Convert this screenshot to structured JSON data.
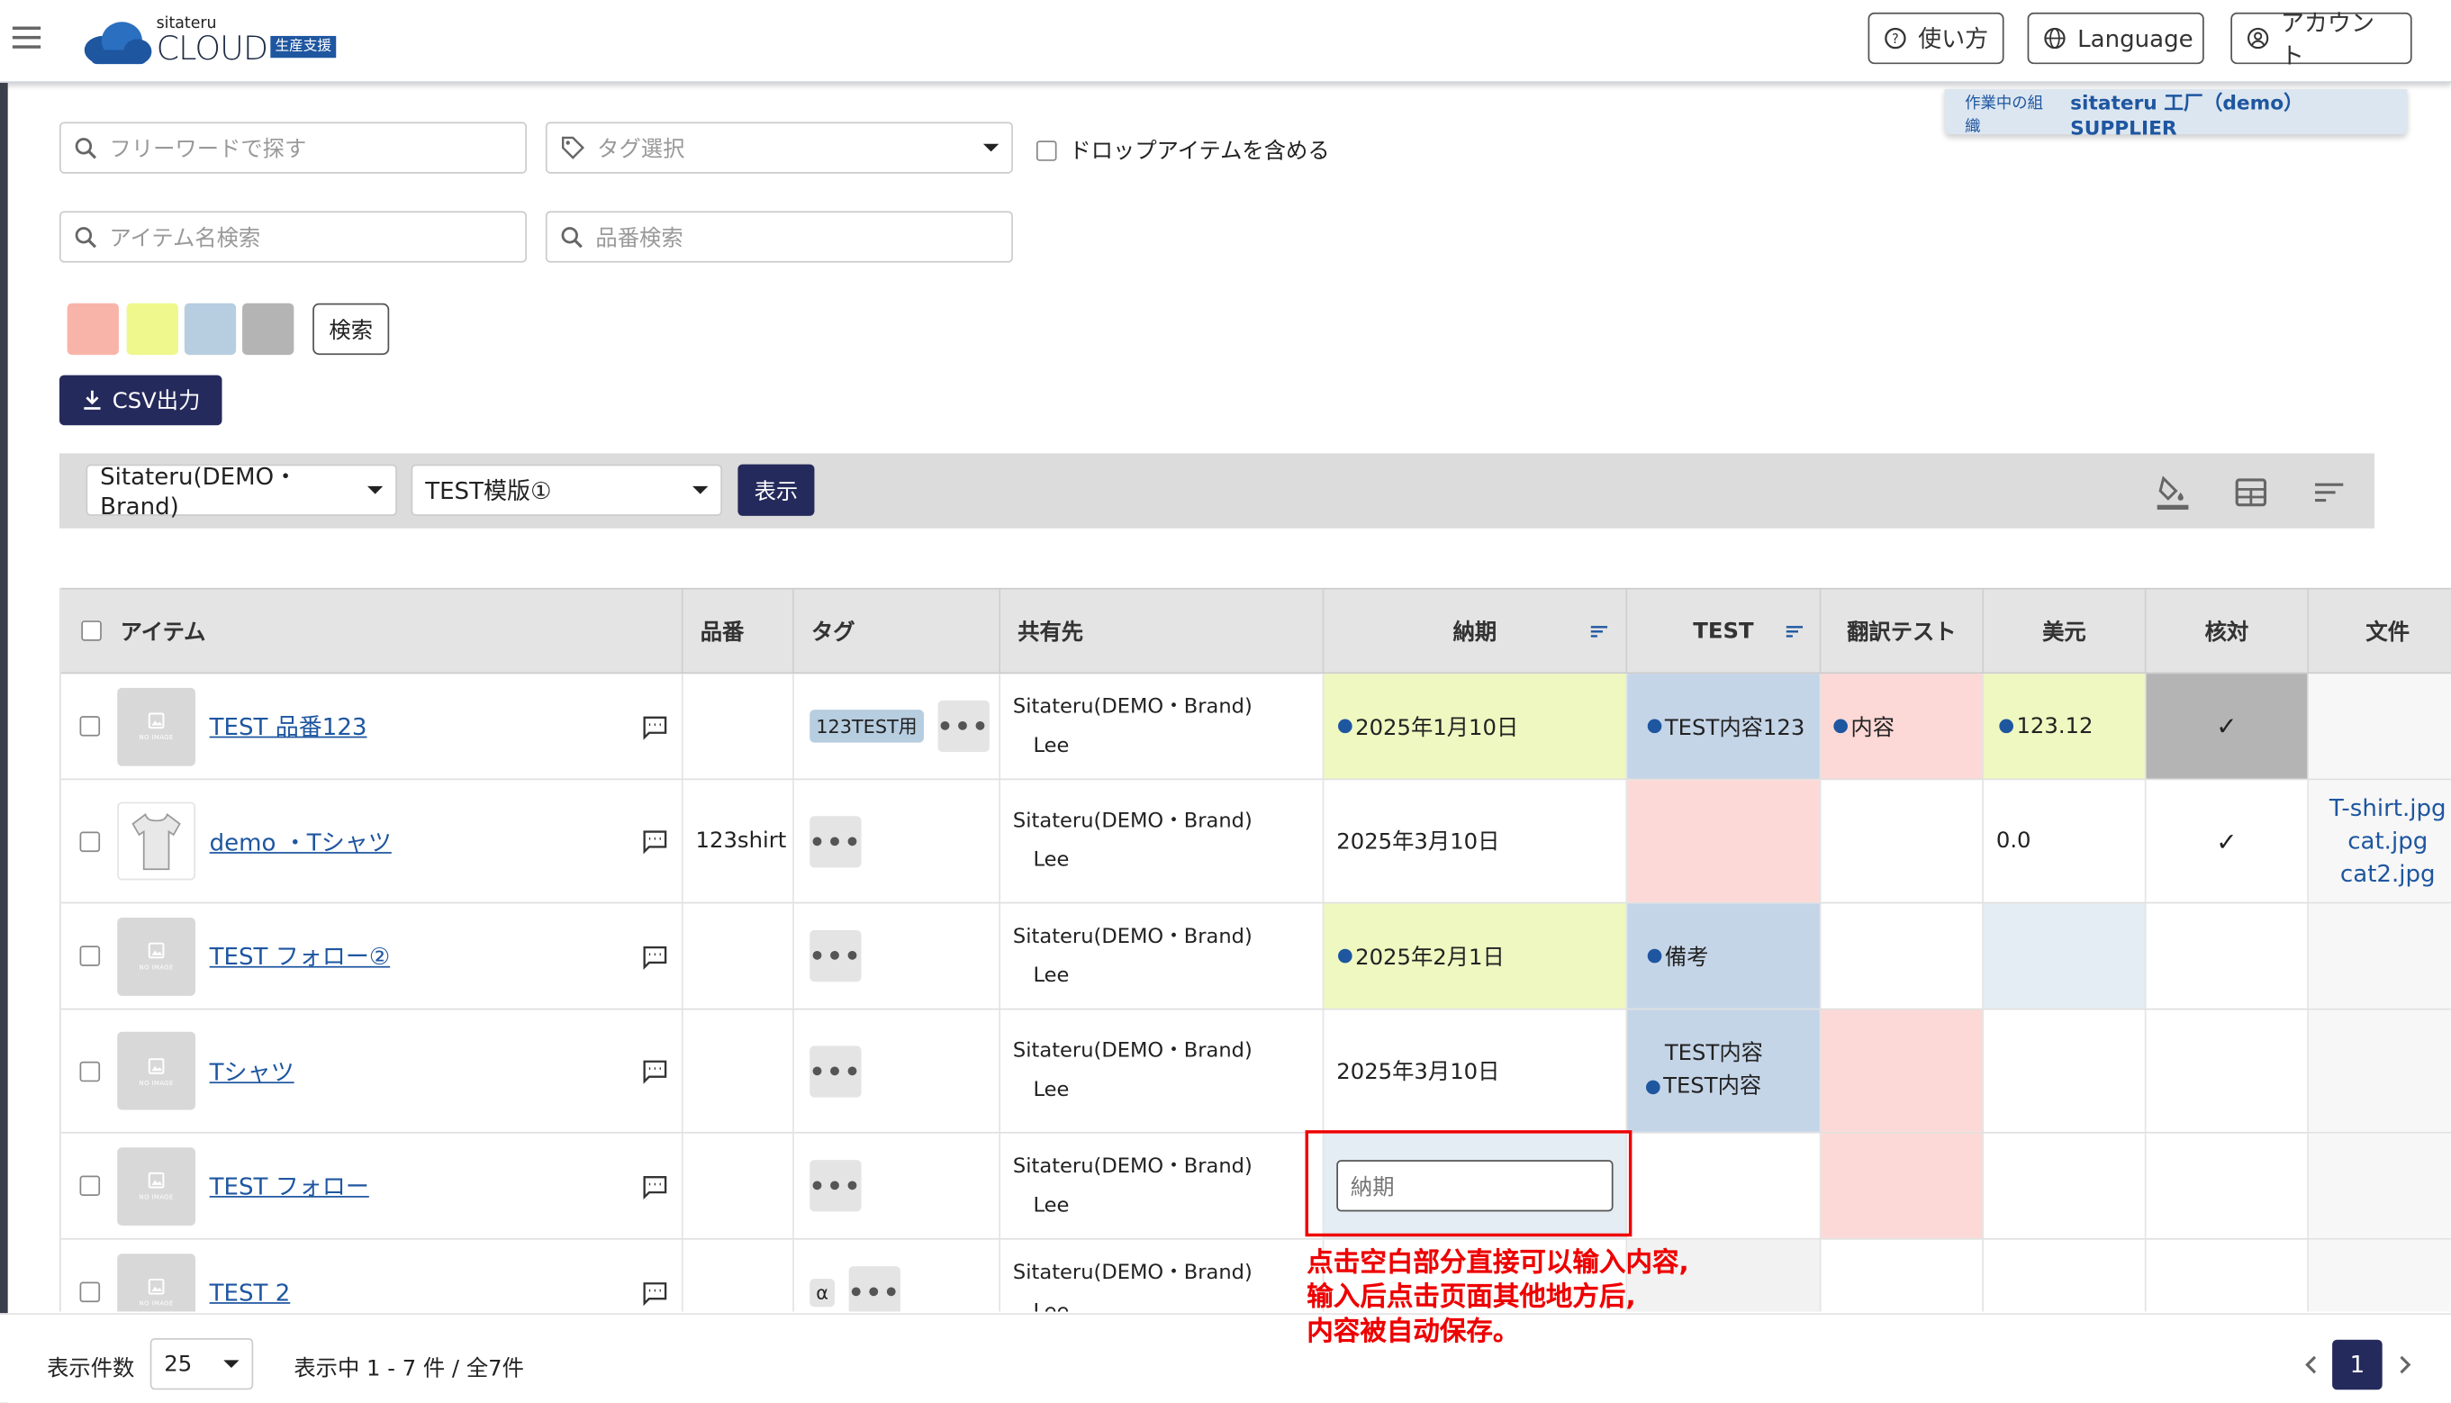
{
  "header": {
    "logo_brand": "sitateru",
    "logo_name": "CLOUD",
    "logo_badge": "生産支援",
    "help_label": "使い方",
    "language_label": "Language",
    "account_label": "アカウント"
  },
  "org_bar": {
    "prefix": "作業中の組織",
    "org_name": "sitateru 工厂（demo） SUPPLIER"
  },
  "filters": {
    "freeword_placeholder": "フリーワードで探す",
    "tag_placeholder": "タグ選択",
    "include_drop_label": "ドロップアイテムを含める",
    "itemname_placeholder": "アイテム名検索",
    "partno_placeholder": "品番検索",
    "color_swatches": [
      "#f9b4a9",
      "#eef88c",
      "#b7cde0",
      "#b4b4b4"
    ],
    "search_label": "検索",
    "csv_label": "CSV出力"
  },
  "toolbar": {
    "brand_select": "Sitateru(DEMO・Brand)",
    "template_select": "TEST模版①",
    "show_label": "表示"
  },
  "table": {
    "headers": {
      "item": "アイテム",
      "partno": "品番",
      "tag": "タグ",
      "share": "共有先",
      "deadline": "納期",
      "test": "TEST",
      "translate": "翻訳テスト",
      "usd": "美元",
      "check": "核対",
      "file": "文件"
    },
    "rows": [
      {
        "name": "TEST 品番123",
        "partno": "",
        "tag": "123TEST用",
        "share_org": "Sitateru(DEMO・Brand)",
        "share_user": "Lee",
        "deadline": "2025年1月10日",
        "deadline_dot": true,
        "test": "TEST内容123",
        "test_dot": true,
        "translate": "内容",
        "translate_dot": true,
        "usd": "123.12",
        "usd_dot": true,
        "check": "✓",
        "files": []
      },
      {
        "name": "demo ・Tシャツ",
        "partno": "123shirt",
        "tag": "",
        "share_org": "Sitateru(DEMO・Brand)",
        "share_user": "Lee",
        "deadline": "2025年3月10日",
        "deadline_dot": false,
        "test": "",
        "translate": "",
        "usd": "0.0",
        "usd_dot": false,
        "check": "✓",
        "files": [
          "T-shirt.jpg",
          "cat.jpg",
          "cat2.jpg"
        ]
      },
      {
        "name": "TEST フォロー②",
        "partno": "",
        "tag": "",
        "share_org": "Sitateru(DEMO・Brand)",
        "share_user": "Lee",
        "deadline": "2025年2月1日",
        "deadline_dot": true,
        "test": "備考",
        "test_dot": true,
        "translate": "",
        "usd": "",
        "check": "",
        "files": []
      },
      {
        "name": "Tシャツ",
        "partno": "",
        "tag": "",
        "share_org": "Sitateru(DEMO・Brand)",
        "share_user": "Lee",
        "deadline": "2025年3月10日",
        "deadline_dot": false,
        "test_line1": "TEST内容",
        "test_line2": "TEST内容",
        "translate": "",
        "usd": "",
        "check": "",
        "files": []
      },
      {
        "name": "TEST フォロー",
        "partno": "",
        "tag": "",
        "share_org": "Sitateru(DEMO・Brand)",
        "share_user": "Lee",
        "deadline_placeholder": "納期",
        "test": "",
        "translate": "",
        "usd": "",
        "check": "",
        "files": []
      },
      {
        "name": "TEST 2",
        "partno": "",
        "tag": "α",
        "share_org": "Sitateru(DEMO・Brand)",
        "share_user": "Lee",
        "test": "",
        "translate": "",
        "usd": "",
        "check": "",
        "files": []
      }
    ]
  },
  "annotation": {
    "line1": "点击空白部分直接可以输入内容,",
    "line2": "输入后点击页面其他地方后,",
    "line3": "内容被自动保存。"
  },
  "footer": {
    "per_page_label": "表示件数",
    "per_page_value": "25",
    "range_text": "表示中 1 - 7 件 / 全7件",
    "current_page": "1"
  },
  "colors": {
    "navy": "#252a5c",
    "blue_link": "#1e56a0",
    "pink": "#fcd9d6",
    "yellow": "#eef8c0",
    "light_blue": "#c5d5e8",
    "grey": "#b4b4b4",
    "annotation_red": "#e00000"
  }
}
